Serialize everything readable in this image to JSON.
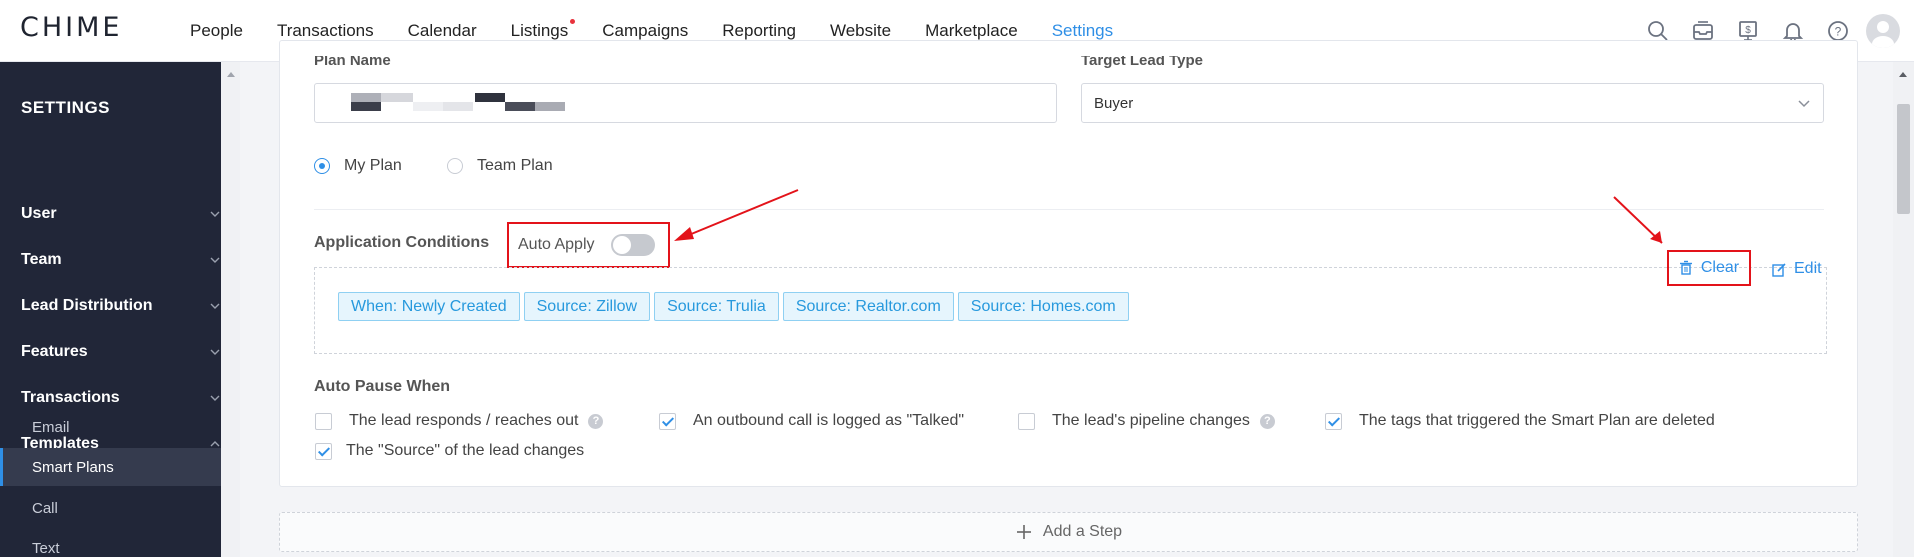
{
  "app": {
    "logo": "CHIME"
  },
  "nav": {
    "items": [
      "People",
      "Transactions",
      "Calendar",
      "Listings",
      "Campaigns",
      "Reporting",
      "Website",
      "Marketplace",
      "Settings"
    ],
    "active": "Settings"
  },
  "top_icons": [
    "search-icon",
    "inbox-icon",
    "billing-icon",
    "bell-icon",
    "help-icon"
  ],
  "sidebar": {
    "title": "SETTINGS",
    "sections": [
      "User",
      "Team",
      "Lead Distribution",
      "Features",
      "Transactions",
      "Templates"
    ],
    "sub_items": [
      "Email",
      "Smart Plans",
      "Call",
      "Text"
    ],
    "active_sub": "Smart Plans"
  },
  "form": {
    "plan_name_label": "Plan Name",
    "target_label": "Target Lead Type",
    "target_value": "Buyer",
    "radio_my": "My Plan",
    "radio_team": "Team Plan",
    "app_conditions": "Application Conditions",
    "auto_apply": "Auto Apply",
    "clear": "Clear",
    "edit": "Edit",
    "tags": [
      "When: Newly Created",
      "Source: Zillow",
      "Source: Trulia",
      "Source: Realtor.com",
      "Source: Homes.com"
    ],
    "auto_pause_title": "Auto Pause When",
    "pause_options": [
      {
        "label": "The lead responds / reaches out",
        "checked": false,
        "help": true
      },
      {
        "label": "An outbound call is logged as \"Talked\"",
        "checked": true,
        "help": false
      },
      {
        "label": "The lead's pipeline changes",
        "checked": false,
        "help": true
      },
      {
        "label": "The tags that triggered the Smart Plan are deleted",
        "checked": true,
        "help": false
      },
      {
        "label": "The \"Source\" of the lead changes",
        "checked": true,
        "help": false
      }
    ],
    "add_step": "Add a Step"
  },
  "colors": {
    "accent": "#2f8fe6",
    "highlight": "#e3131a",
    "sidebar": "#212638"
  }
}
